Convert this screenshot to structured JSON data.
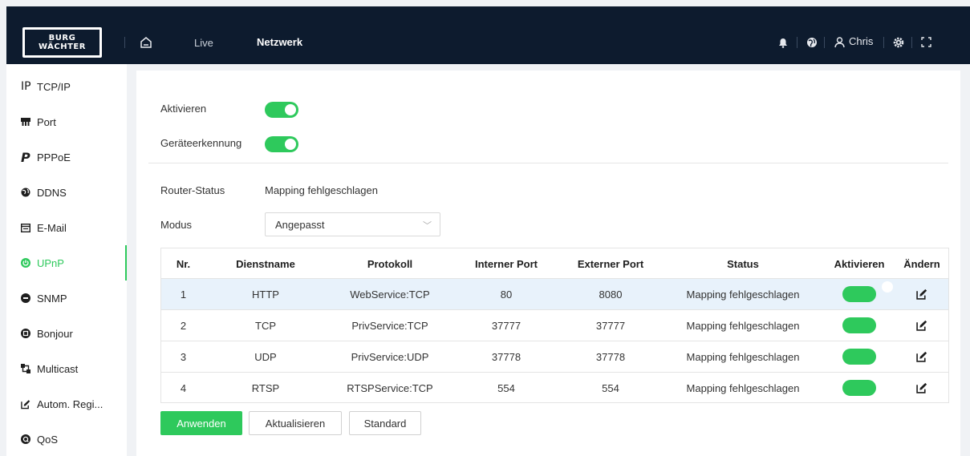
{
  "brand": {
    "line1": "BURG",
    "line2": "WÄCHTER"
  },
  "topbar": {
    "nav": [
      {
        "label": "Live"
      },
      {
        "label": "Netzwerk"
      }
    ],
    "user_name": "Chris",
    "icons": [
      "home-icon",
      "bell-icon",
      "globe-icon",
      "user-icon",
      "settings-icon",
      "fullscreen-icon"
    ]
  },
  "sidebar": {
    "items": [
      {
        "icon": "IP",
        "label": "TCP/IP"
      },
      {
        "icon": "port-icon",
        "label": "Port"
      },
      {
        "icon": "P",
        "label": "PPPoE"
      },
      {
        "icon": "ddns-icon",
        "label": "DDNS"
      },
      {
        "icon": "mail-icon",
        "label": "E-Mail"
      },
      {
        "icon": "power-icon",
        "label": "UPnP",
        "active": true
      },
      {
        "icon": "snmp-icon",
        "label": "SNMP"
      },
      {
        "icon": "bonjour-icon",
        "label": "Bonjour"
      },
      {
        "icon": "multicast-icon",
        "label": "Multicast"
      },
      {
        "icon": "edit-icon",
        "label": "Autom. Regi..."
      },
      {
        "icon": "qos-icon",
        "label": "QoS"
      }
    ]
  },
  "form": {
    "enable_label": "Aktivieren",
    "device_discovery_label": "Geräteerkennung",
    "router_status_label": "Router-Status",
    "router_status_value": "Mapping fehlgeschlagen",
    "mode_label": "Modus",
    "mode_value": "Angepasst"
  },
  "table": {
    "headers": [
      "Nr.",
      "Dienstname",
      "Protokoll",
      "Interner Port",
      "Externer Port",
      "Status",
      "Aktivieren",
      "Ändern"
    ],
    "rows": [
      {
        "nr": "1",
        "name": "HTTP",
        "protocol": "WebService:TCP",
        "internal": "80",
        "external": "8080",
        "status": "Mapping fehlgeschlagen",
        "enabled": true
      },
      {
        "nr": "2",
        "name": "TCP",
        "protocol": "PrivService:TCP",
        "internal": "37777",
        "external": "37777",
        "status": "Mapping fehlgeschlagen",
        "enabled": true
      },
      {
        "nr": "3",
        "name": "UDP",
        "protocol": "PrivService:UDP",
        "internal": "37778",
        "external": "37778",
        "status": "Mapping fehlgeschlagen",
        "enabled": true
      },
      {
        "nr": "4",
        "name": "RTSP",
        "protocol": "RTSPService:TCP",
        "internal": "554",
        "external": "554",
        "status": "Mapping fehlgeschlagen",
        "enabled": true
      }
    ]
  },
  "buttons": {
    "apply": "Anwenden",
    "refresh": "Aktualisieren",
    "default": "Standard"
  },
  "colors": {
    "accent": "#2ec95c",
    "topbar": "#0d1b2e",
    "selected_row": "#e8f2fb"
  }
}
